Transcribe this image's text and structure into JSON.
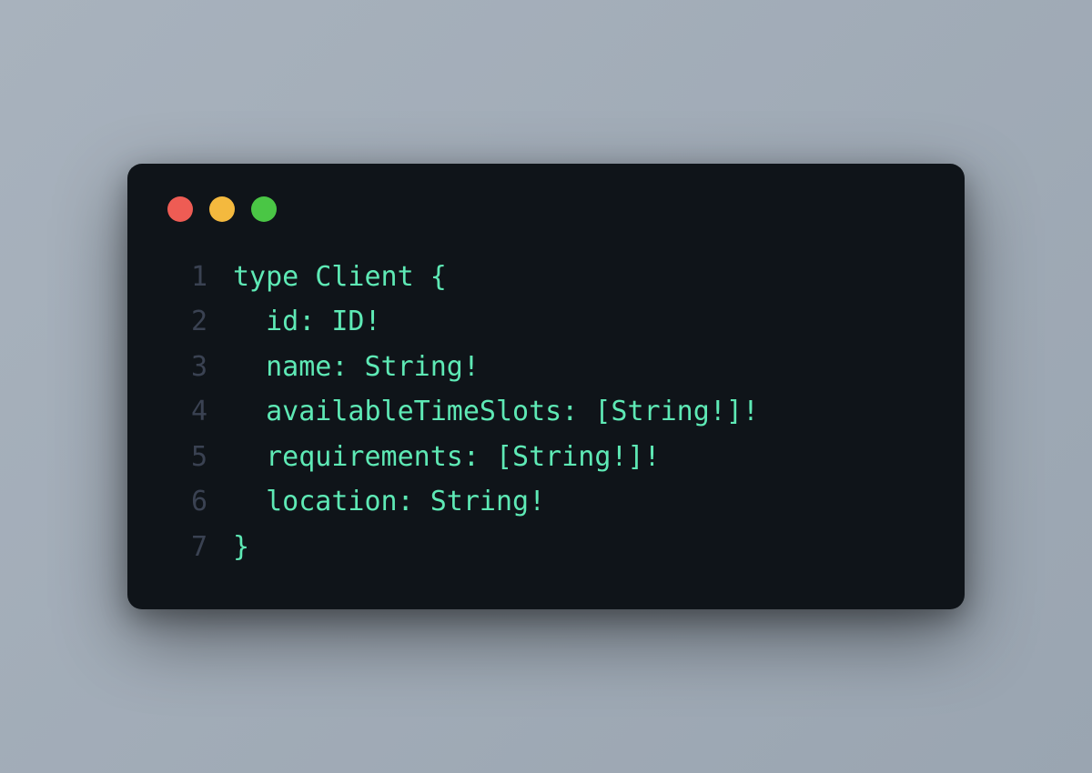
{
  "window": {
    "traffic_lights": {
      "red": "#ee5c54",
      "yellow": "#f4b93e",
      "green": "#4ac645"
    }
  },
  "code": {
    "lines": [
      {
        "num": "1",
        "text": "type Client {"
      },
      {
        "num": "2",
        "text": "  id: ID!"
      },
      {
        "num": "3",
        "text": "  name: String!"
      },
      {
        "num": "4",
        "text": "  availableTimeSlots: [String!]!"
      },
      {
        "num": "5",
        "text": "  requirements: [String!]!"
      },
      {
        "num": "6",
        "text": "  location: String!"
      },
      {
        "num": "7",
        "text": "}"
      }
    ],
    "syntax_color": "#5ee9b5",
    "line_number_color": "#3a4252"
  },
  "theme": {
    "editor_bg": "#0f1419",
    "page_bg": "#a8b2bd"
  }
}
